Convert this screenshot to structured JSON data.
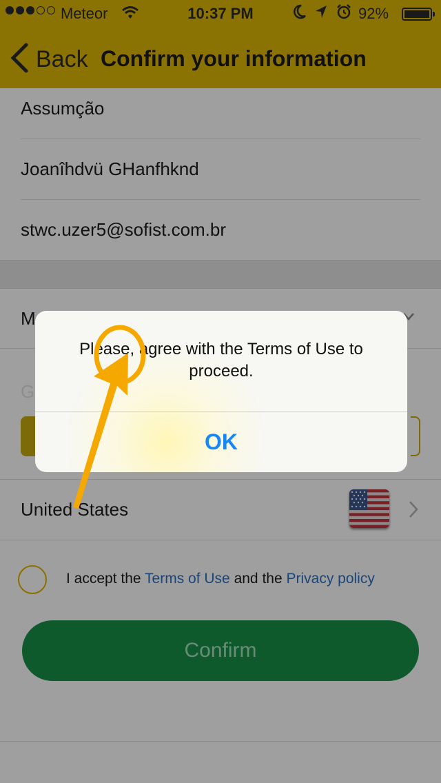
{
  "status_bar": {
    "carrier": "Meteor",
    "time": "10:37 PM",
    "battery": "92%",
    "signal_icon": "signal-dots-icon",
    "wifi_icon": "wifi-icon",
    "moon_icon": "moon-icon",
    "location_icon": "location-arrow-icon",
    "alarm_icon": "alarm-clock-icon",
    "battery_icon": "battery-icon"
  },
  "nav": {
    "back_label": "Back",
    "title": "Confirm your information"
  },
  "form": {
    "last_name": "Assumção",
    "first_name": "Joanîhdvü GHanfhknd",
    "email": "stwc.uzer5@sofist.com.br",
    "country": "United States",
    "country_flag": "us-flag-icon"
  },
  "terms": {
    "prefix": "I accept the ",
    "terms_link": "Terms of Use",
    "middle": " and the ",
    "privacy_link": "Privacy policy"
  },
  "confirm_button": "Confirm",
  "alert": {
    "message": "Please, agree with the Terms of Use to proceed.",
    "ok_label": "OK"
  },
  "colors": {
    "nav_bg": "#8b7303",
    "screen_dim": "#9f9f9f",
    "confirm_bg": "#0f5a2c",
    "link": "#18467a",
    "alert_ok": "#1687f4",
    "annotation": "#f5a800"
  }
}
